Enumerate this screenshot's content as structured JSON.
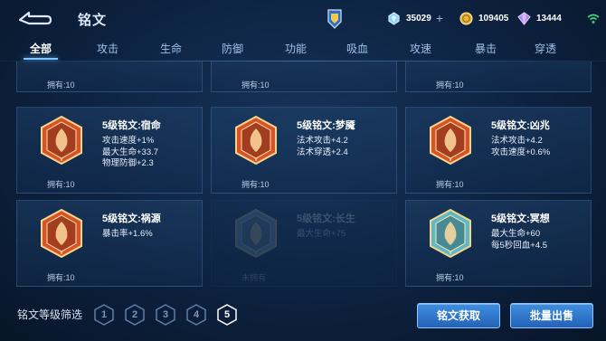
{
  "header": {
    "title": "铭文",
    "back_icon": "back-arrow-icon",
    "badge_icon": "rank-badge-icon"
  },
  "currencies": [
    {
      "icon": "diamond-icon",
      "value": "35029",
      "has_plus": true,
      "plus_label": "+"
    },
    {
      "icon": "gold-coin-icon",
      "value": "109405",
      "has_plus": false
    },
    {
      "icon": "purple-crystal-icon",
      "value": "13444",
      "has_plus": false
    }
  ],
  "status": {
    "wifi_icon": "wifi-icon"
  },
  "tabs": [
    {
      "label": "全部",
      "active": true
    },
    {
      "label": "攻击",
      "active": false
    },
    {
      "label": "生命",
      "active": false
    },
    {
      "label": "防御",
      "active": false
    },
    {
      "label": "功能",
      "active": false
    },
    {
      "label": "吸血",
      "active": false
    },
    {
      "label": "攻速",
      "active": false
    },
    {
      "label": "暴击",
      "active": false
    },
    {
      "label": "穿透",
      "active": false
    }
  ],
  "top_row_own": [
    "拥有:10",
    "拥有:10",
    "拥有:10"
  ],
  "cards": [
    {
      "name": "5级铭文:宿命",
      "attrs": [
        "攻击速度+1%",
        "最大生命+33.7",
        "物理防御+2.3"
      ],
      "own": "拥有:10",
      "color": "#d9532a",
      "icon": "fate-gem-icon",
      "dim": false
    },
    {
      "name": "5级铭文:梦魇",
      "attrs": [
        "法术攻击+4.2",
        "法术穿透+2.4"
      ],
      "own": "拥有:10",
      "color": "#d9532a",
      "icon": "nightmare-gem-icon",
      "dim": false
    },
    {
      "name": "5级铭文:凶兆",
      "attrs": [
        "法术攻击+4.2",
        "攻击速度+0.6%"
      ],
      "own": "拥有:10",
      "color": "#d9532a",
      "icon": "omen-gem-icon",
      "dim": false
    },
    {
      "name": "5级铭文:祸源",
      "attrs": [
        "暴击率+1.6%"
      ],
      "own": "拥有:10",
      "color": "#d9532a",
      "icon": "calamity-gem-icon",
      "dim": false
    },
    {
      "name": "5级铭文:长生",
      "attrs": [
        "最大生命+75"
      ],
      "own": "未拥有",
      "color": "#7fb0d8",
      "icon": "longevity-gem-icon",
      "dim": true
    },
    {
      "name": "5级铭文:冥想",
      "attrs": [
        "最大生命+60",
        "每5秒回血+4.5"
      ],
      "own": "拥有:10",
      "color": "#5fb8c8",
      "icon": "meditation-gem-icon",
      "dim": false
    }
  ],
  "filter": {
    "label": "铭文等级筛选",
    "levels": [
      "1",
      "2",
      "3",
      "4",
      "5"
    ],
    "active_level": "5"
  },
  "buttons": {
    "get_label": "铭文获取",
    "sell_label": "批量出售"
  }
}
